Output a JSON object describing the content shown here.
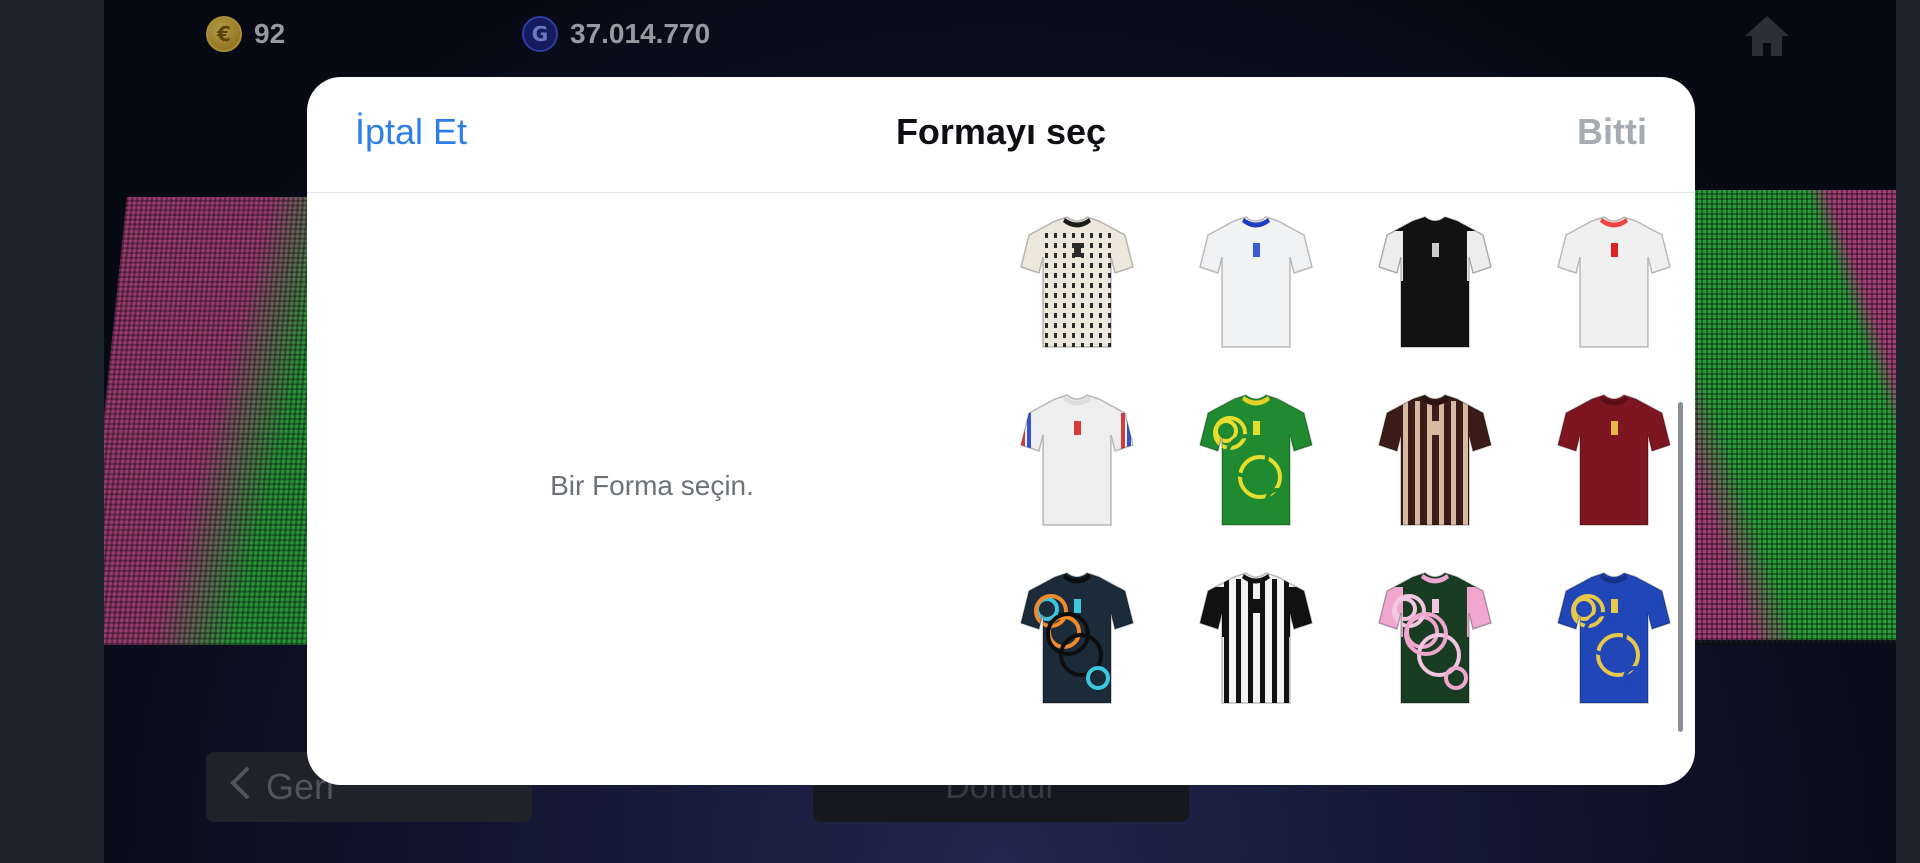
{
  "hud": {
    "coins": "92",
    "gp": "37.014.770"
  },
  "background": {
    "back_label": "Geri",
    "confirm_label": "Dondur"
  },
  "modal": {
    "cancel_label": "İptal Et",
    "title": "Formayı seç",
    "done_label": "Bitti",
    "empty_hint": "Bir Forma seçin."
  },
  "kits": [
    {
      "name": "kit-cream-pattern",
      "body": "#ece8dc",
      "sleeve": "#ece8dc",
      "collar": "#1a1a1a",
      "accent": "#2b2b2b",
      "pattern": "dots"
    },
    {
      "name": "kit-white-blue-collar",
      "body": "#f1f2f4",
      "sleeve": "#f1f2f4",
      "collar": "#1d3fbf",
      "accent": "#3a5ad8",
      "pattern": "plain"
    },
    {
      "name": "kit-black-white-sleeves",
      "body": "#121212",
      "sleeve": "#ededed",
      "collar": "#121212",
      "accent": "#cccccc",
      "pattern": "plain"
    },
    {
      "name": "kit-white-red-badge",
      "body": "#f0f0f0",
      "sleeve": "#f0f0f0",
      "collar": "#e44",
      "accent": "#d22",
      "pattern": "plain"
    },
    {
      "name": "kit-white-tricolor-sleeves",
      "body": "#eeeeee",
      "sleeve": "#eeeeee",
      "collar": "#dddddd",
      "accent": "#d53b3b",
      "pattern": "stripe-sleeve"
    },
    {
      "name": "kit-green-yellow-efootball",
      "body": "#1f8a2f",
      "sleeve": "#1f8a2f",
      "collar": "#e0d22a",
      "accent": "#e6dd2f",
      "pattern": "swirl"
    },
    {
      "name": "kit-dark-brown-efootball",
      "body": "#3a1c18",
      "sleeve": "#3a1c18",
      "collar": "#2a1310",
      "accent": "#d7b9a2",
      "pattern": "vstripes"
    },
    {
      "name": "kit-maroon-telekom",
      "body": "#7d1620",
      "sleeve": "#7d1620",
      "collar": "#5a0f16",
      "accent": "#e6b84a",
      "pattern": "plain"
    },
    {
      "name": "kit-black-teal-tiedye",
      "body": "#1b2b3a",
      "sleeve": "#1b2b3a",
      "collar": "#0d0d0d",
      "accent": "#3fc6df",
      "pattern": "tiedye"
    },
    {
      "name": "kit-black-white-stripes",
      "body": "#f2f2f2",
      "sleeve": "#111111",
      "collar": "#111111",
      "accent": "#111111",
      "pattern": "bw-stripes"
    },
    {
      "name": "kit-pink-green-dragon",
      "body": "#183d22",
      "sleeve": "#f0a6cf",
      "collar": "#f0a6cf",
      "accent": "#f5c6e1",
      "pattern": "dragon"
    },
    {
      "name": "kit-blue-efootball",
      "body": "#2046b8",
      "sleeve": "#2046b8",
      "collar": "#163288",
      "accent": "#e8c84a",
      "pattern": "mosaic"
    }
  ]
}
